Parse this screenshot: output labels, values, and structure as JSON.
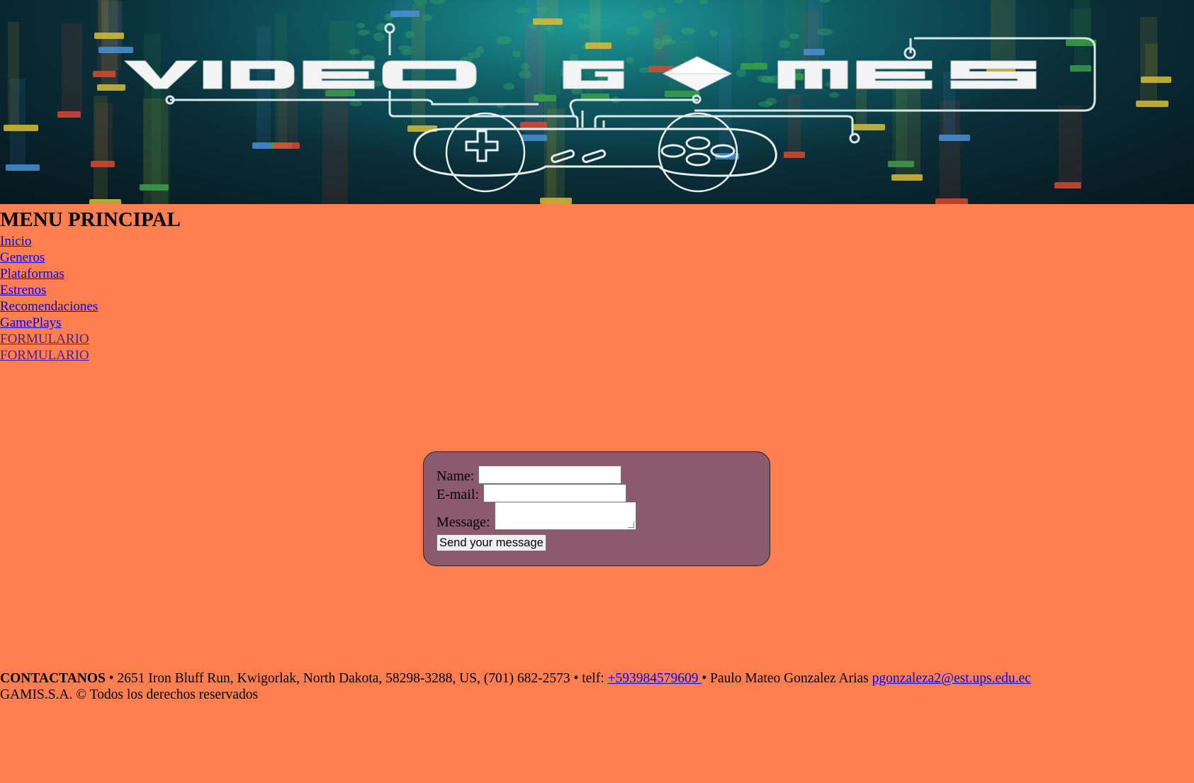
{
  "banner": {
    "title_text": "VIDEO GAMES",
    "title_part1": "VIDEO G",
    "title_part2": "MES",
    "image_description": "video-games-controller-banner"
  },
  "menu": {
    "heading": "MENU PRINCIPAL",
    "items": [
      {
        "label": "Inicio",
        "visited": false
      },
      {
        "label": "Generos",
        "visited": false
      },
      {
        "label": "Plataformas",
        "visited": false
      },
      {
        "label": "Estrenos",
        "visited": false
      },
      {
        "label": "Recomendaciones",
        "visited": false
      },
      {
        "label": "GamePlays",
        "visited": false
      },
      {
        "label": "FORMULARIO",
        "visited": true
      },
      {
        "label": "FORMULARIO",
        "visited": true
      }
    ]
  },
  "form": {
    "name_label": "Name:",
    "name_value": "",
    "email_label": "E-mail:",
    "email_value": "",
    "message_label": "Message:",
    "message_value": "",
    "submit_label": "Send your message"
  },
  "footer": {
    "contact_heading": "CONTACTANOS",
    "address_text": " • 2651 Iron Bluff Run, Kwigorlak, North Dakota, 58298-3288, US, (701) 682-2573 • telf: ",
    "phone_link": "+593984579609 ",
    "author_text": " • Paulo Mateo Gonzalez Arias ",
    "email_link": "pgonzaleza2@est.ups.edu.ec ",
    "copyright": "GAMIS.S.A. © Todos los derechos reservados"
  },
  "colors": {
    "page_background": "#ff7f50",
    "form_background": "#8b5a6c",
    "link": "#0000ee",
    "visited_link": "#551a8b"
  }
}
